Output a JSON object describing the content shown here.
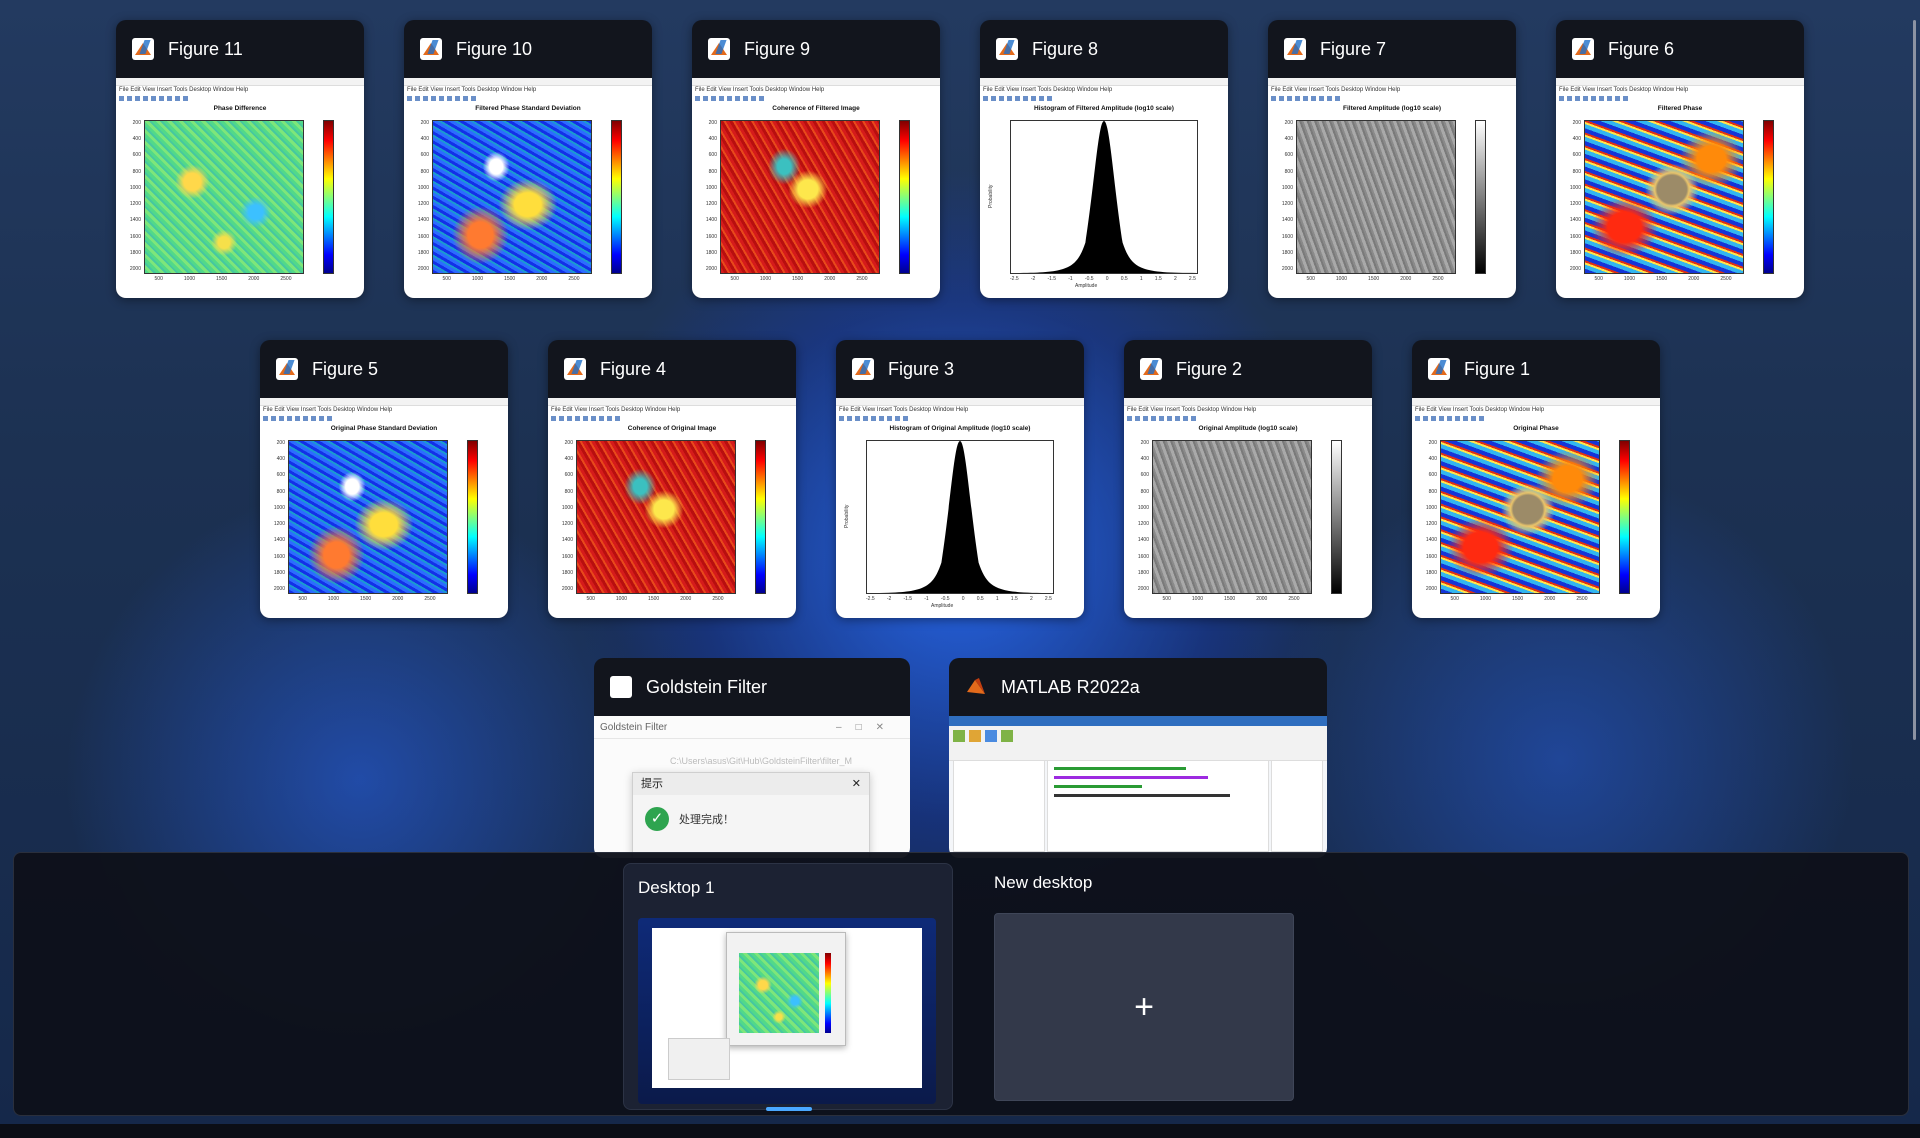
{
  "windows_row1": [
    {
      "title": "Figure 11",
      "plot_title": "Phase Difference",
      "kind": "green"
    },
    {
      "title": "Figure 10",
      "plot_title": "Filtered Phase Standard Deviation",
      "kind": "blue"
    },
    {
      "title": "Figure 9",
      "plot_title": "Coherence of Filtered Image",
      "kind": "red"
    },
    {
      "title": "Figure 8",
      "plot_title": "Histogram of Filtered Amplitude (log10 scale)",
      "kind": "hist"
    },
    {
      "title": "Figure 7",
      "plot_title": "Filtered Amplitude (log10 scale)",
      "kind": "amp"
    },
    {
      "title": "Figure 6",
      "plot_title": "Filtered Phase",
      "kind": "phase"
    }
  ],
  "windows_row2": [
    {
      "title": "Figure 5",
      "plot_title": "Original Phase Standard Deviation",
      "kind": "blue"
    },
    {
      "title": "Figure 4",
      "plot_title": "Coherence of Original Image",
      "kind": "red"
    },
    {
      "title": "Figure 3",
      "plot_title": "Histogram of Original Amplitude (log10 scale)",
      "kind": "hist"
    },
    {
      "title": "Figure 2",
      "plot_title": "Original Amplitude (log10 scale)",
      "kind": "amp"
    },
    {
      "title": "Figure 1",
      "plot_title": "Original Phase",
      "kind": "phase"
    }
  ],
  "figure_menu": "File  Edit  View  Insert  Tools  Desktop  Window  Help",
  "y_ticks": [
    "200",
    "400",
    "600",
    "800",
    "1000",
    "1200",
    "1400",
    "1600",
    "1800",
    "2000"
  ],
  "x_ticks": [
    "500",
    "1000",
    "1500",
    "2000",
    "2500"
  ],
  "hist_x_ticks": [
    "-2.5",
    "-2",
    "-1.5",
    "-1",
    "-0.5",
    "0",
    "0.5",
    "1",
    "1.5",
    "2",
    "2.5"
  ],
  "hist_xlabel": "Amplitude",
  "hist_ylabel": "Probability",
  "goldstein": {
    "title": "Goldstein Filter",
    "inner_title": "Goldstein Filter",
    "path": "C:\\Users\\asus\\Git\\Hub\\GoldsteinFilter\\filter_M",
    "dialog_title": "提示",
    "dialog_text": "处理完成！"
  },
  "matlab": {
    "title": "MATLAB R2022a"
  },
  "taskview": {
    "desktop1": "Desktop 1",
    "new_desktop": "New desktop",
    "plus": "+"
  }
}
